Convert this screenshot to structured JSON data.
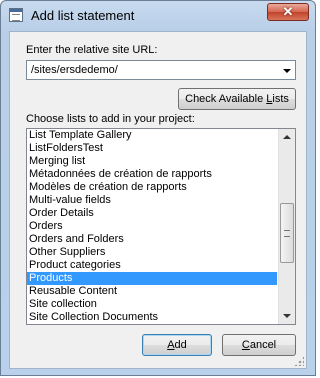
{
  "window": {
    "title": "Add list statement",
    "close_label": "✕"
  },
  "site_url": {
    "label": "Enter the relative site URL:",
    "value": "/sites/ersdedemo/"
  },
  "check_button": {
    "label_before": "Check Available ",
    "label_underlined": "L",
    "label_after": "ists"
  },
  "lists": {
    "label": "Choose lists to add in your project:",
    "items": [
      "List Template Gallery",
      "ListFoldersTest",
      "Merging list",
      "Métadonnées de création de rapports",
      "Modèles de création de rapports",
      "Multi-value fields",
      "Order Details",
      "Orders",
      "Orders and Folders",
      "Other Suppliers",
      "Product categories",
      "Products",
      "Reusable Content",
      "Site collection",
      "Site Collection Documents"
    ],
    "selected_index": 11
  },
  "buttons": {
    "add": {
      "underlined": "A",
      "rest": "dd"
    },
    "cancel": {
      "underlined": "C",
      "rest": "ancel"
    }
  }
}
